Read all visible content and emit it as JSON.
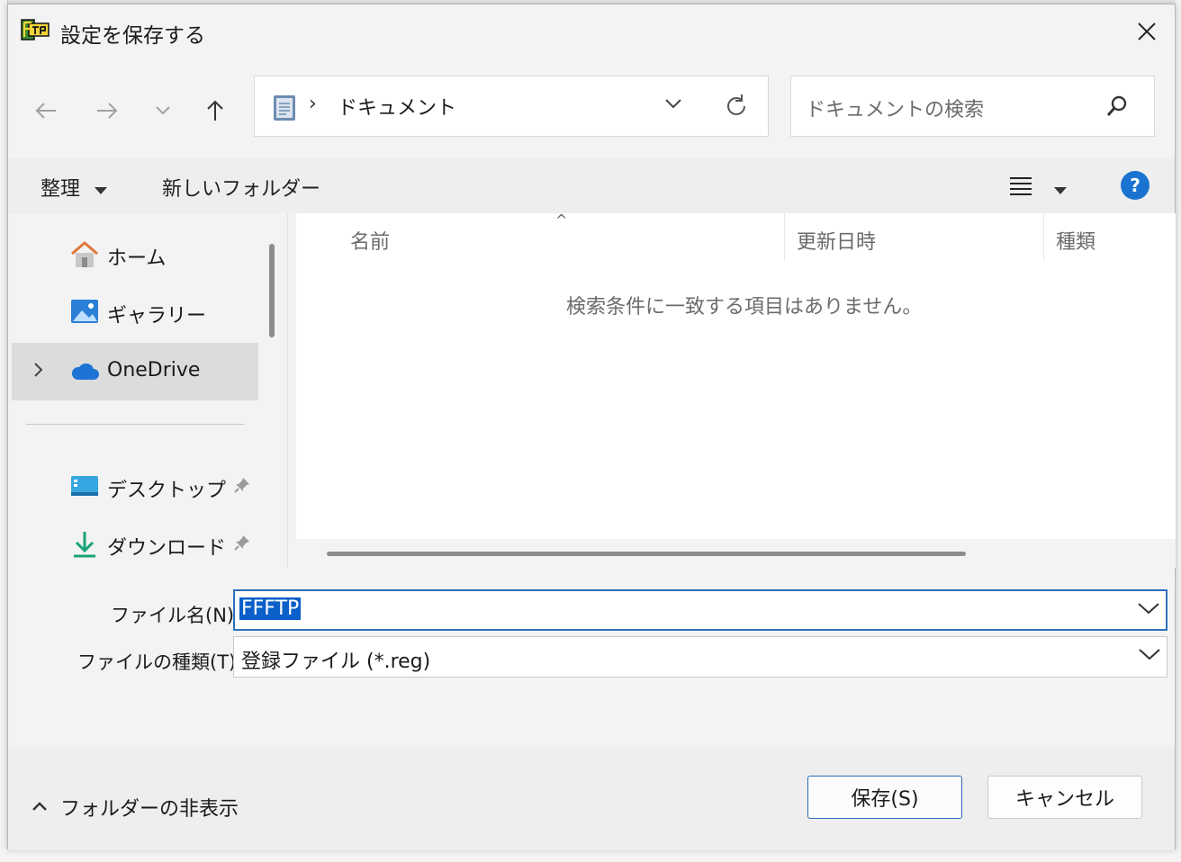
{
  "dialog": {
    "title": "設定を保存する",
    "app_icon": "fftp-app-icon"
  },
  "nav": {
    "back_icon": "arrow-left-icon",
    "forward_icon": "arrow-right-icon",
    "recent_icon": "chevron-down-icon",
    "up_icon": "arrow-up-icon",
    "address_separator": "›",
    "address_location": "ドキュメント",
    "search_placeholder": "ドキュメントの検索"
  },
  "toolbar": {
    "organize_label": "整理",
    "new_folder_label": "新しいフォルダー",
    "help_label": "?"
  },
  "sidebar": {
    "items": [
      {
        "label": "ホーム",
        "icon": "home-icon"
      },
      {
        "label": "ギャラリー",
        "icon": "gallery-icon"
      },
      {
        "label": "OneDrive",
        "icon": "cloud-icon",
        "selected": true
      },
      {
        "label": "デスクトップ",
        "icon": "desktop-icon",
        "pinned": true
      },
      {
        "label": "ダウンロード",
        "icon": "download-icon",
        "pinned": true
      }
    ]
  },
  "file_list": {
    "columns": [
      "名前",
      "更新日時",
      "種類"
    ],
    "sort_indicator": "^",
    "empty_message": "検索条件に一致する項目はありません。"
  },
  "form": {
    "filename_label": "ファイル名(N):",
    "filename_value": "FFFTP",
    "filetype_label": "ファイルの種類(T):",
    "filetype_value": "登録ファイル (*.reg)"
  },
  "footer": {
    "hide_folders_label": "フォルダーの非表示",
    "save_label": "保存(S)",
    "cancel_label": "キャンセル"
  },
  "colors": {
    "accent": "#0a5fc8",
    "help_blue": "#1a73d0",
    "selection_bg": "#dcdcdc"
  }
}
